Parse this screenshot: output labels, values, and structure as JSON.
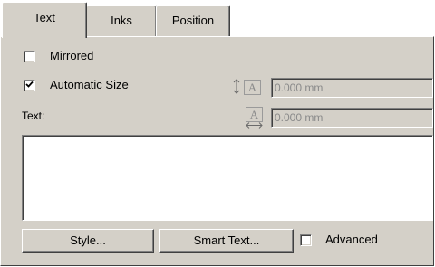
{
  "tabs": [
    {
      "label": "Text",
      "active": true
    },
    {
      "label": "Inks",
      "active": false
    },
    {
      "label": "Position",
      "active": false
    }
  ],
  "options": {
    "mirrored": {
      "label": "Mirrored",
      "checked": false
    },
    "automatic_size": {
      "label": "Automatic Size",
      "checked": true
    }
  },
  "size": {
    "height_icon": "vertical-resize-icon",
    "height_glyph": "A",
    "height_value": "0.000 mm",
    "width_icon": "horizontal-resize-icon",
    "width_glyph": "A",
    "width_value": "0.000 mm"
  },
  "text_section": {
    "label": "Text:",
    "value": ""
  },
  "buttons": {
    "style": "Style...",
    "smart_text": "Smart Text..."
  },
  "advanced": {
    "label": "Advanced",
    "checked": false
  },
  "colors": {
    "face": "#d4d0c8",
    "disabled_text": "#8a8a8a"
  }
}
